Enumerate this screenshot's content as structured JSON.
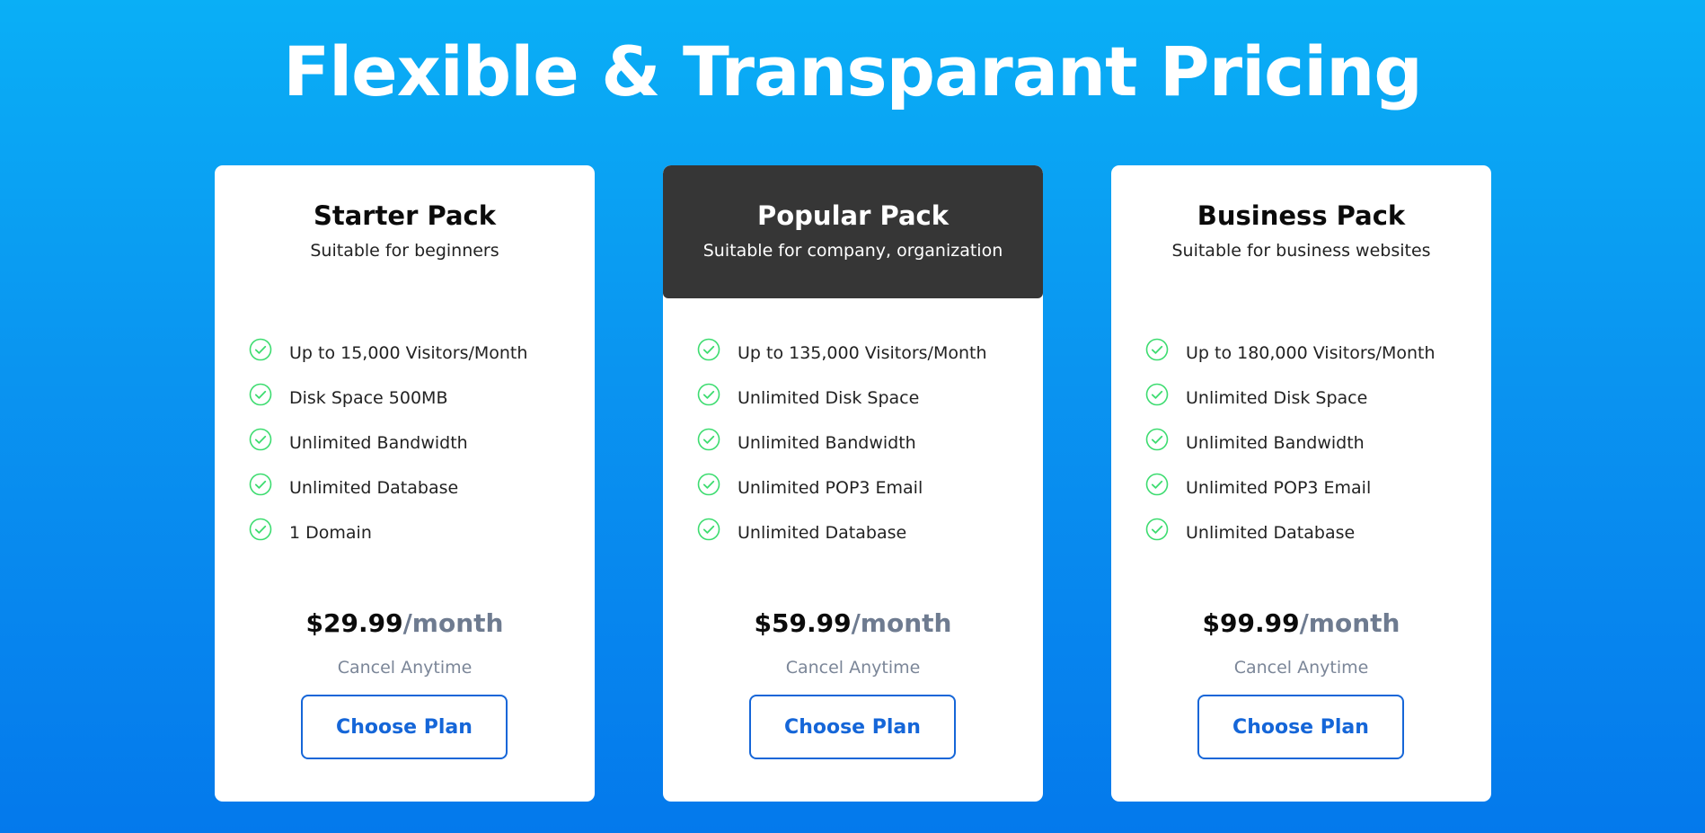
{
  "page": {
    "title": "Flexible & Transparant Pricing"
  },
  "colors": {
    "background_top": "#0aaff6",
    "background_bottom": "#0479ec",
    "featured_header": "#363636",
    "check_icon": "#3ddc70",
    "button_accent": "#1566d8",
    "price_period": "#6e7b90"
  },
  "icons": {
    "feature_check": "check-circle-icon"
  },
  "plans": [
    {
      "name": "Starter Pack",
      "subtitle": "Suitable for beginners",
      "featured": false,
      "features": [
        "Up to 15,000 Visitors/Month",
        "Disk Space 500MB",
        "Unlimited Bandwidth",
        "Unlimited Database",
        "1 Domain"
      ],
      "price": "$29.99",
      "period": "/month",
      "note": "Cancel Anytime",
      "button_label": "Choose Plan"
    },
    {
      "name": "Popular Pack",
      "subtitle": "Suitable for company, organization",
      "featured": true,
      "features": [
        "Up to 135,000 Visitors/Month",
        "Unlimited Disk Space",
        "Unlimited Bandwidth",
        "Unlimited POP3 Email",
        "Unlimited Database"
      ],
      "price": "$59.99",
      "period": "/month",
      "note": "Cancel Anytime",
      "button_label": "Choose Plan"
    },
    {
      "name": "Business Pack",
      "subtitle": "Suitable for business websites",
      "featured": false,
      "features": [
        "Up to 180,000 Visitors/Month",
        "Unlimited Disk Space",
        "Unlimited Bandwidth",
        "Unlimited POP3 Email",
        "Unlimited Database"
      ],
      "price": "$99.99",
      "period": "/month",
      "note": "Cancel Anytime",
      "button_label": "Choose Plan"
    }
  ]
}
